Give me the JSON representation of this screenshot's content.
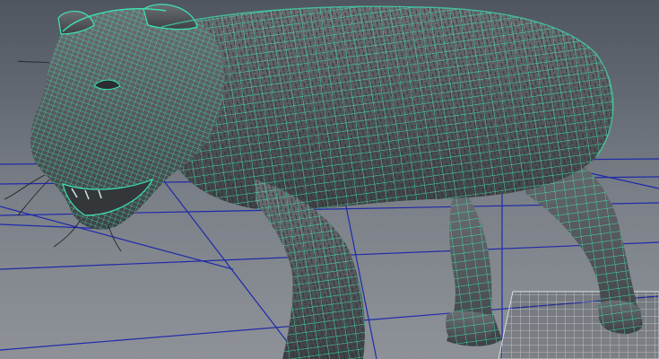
{
  "viewport": {
    "background_top": "#4f5660",
    "background_bottom": "#8e9298",
    "grid_color": "#1f2aa8",
    "wireframe_color": "#3de3b4",
    "mesh_fill": "#55585c",
    "selected_object": "jaguar-mesh",
    "display_mode": "wireframe-on-shaded"
  }
}
